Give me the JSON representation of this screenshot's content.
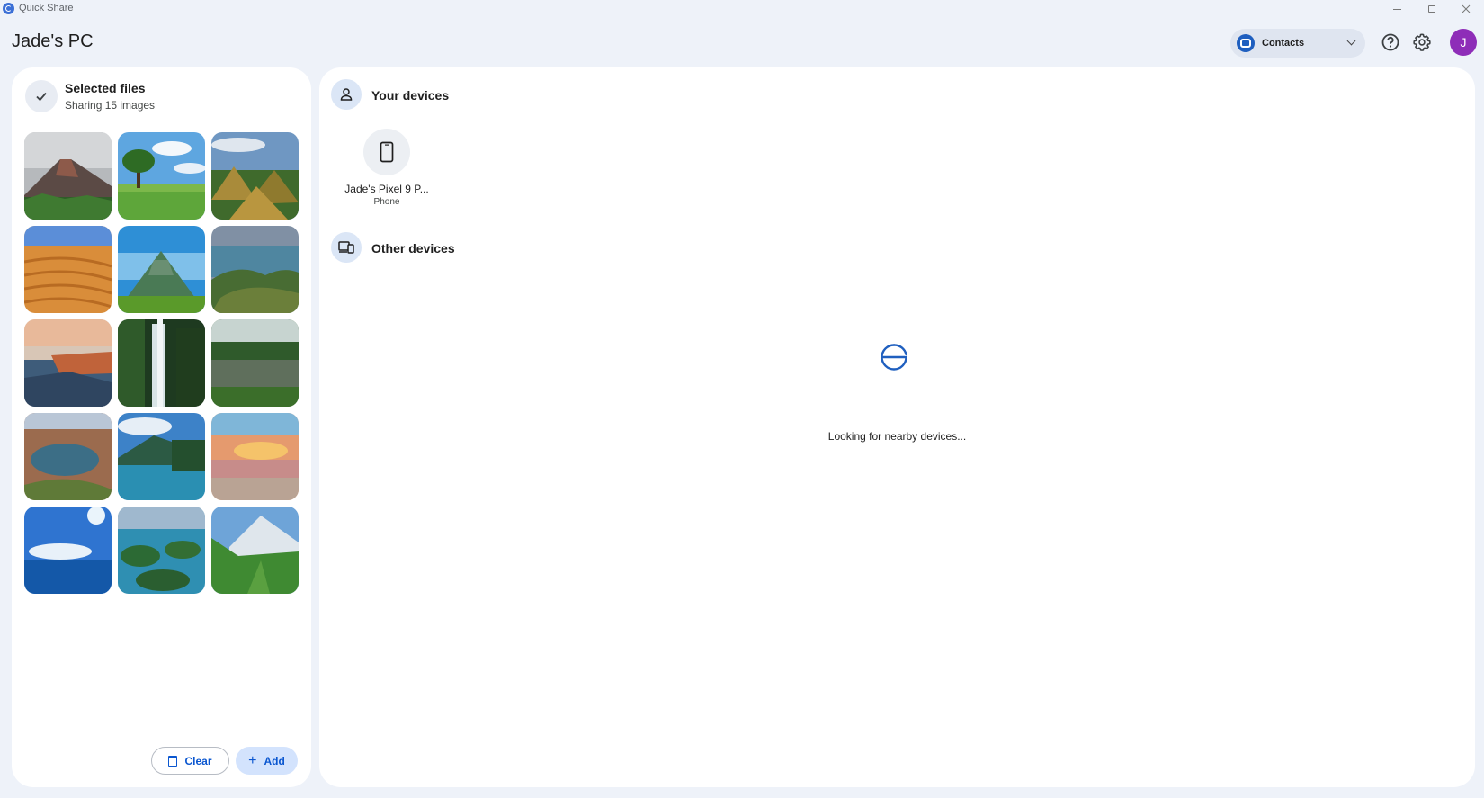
{
  "window": {
    "app_title": "Quick Share"
  },
  "header": {
    "pc_name": "Jade's PC",
    "contacts_label": "Contacts",
    "avatar_letter": "J"
  },
  "selected_files": {
    "title": "Selected files",
    "subtitle": "Sharing 15 images",
    "images": [
      "volcano",
      "tree-meadow",
      "chocolate-hills",
      "desert-dunes",
      "green-volcano",
      "island-aerial",
      "cliff-plateau",
      "waterfall",
      "forest-pond",
      "crater-lake",
      "mountain-lake",
      "sunset-beach",
      "ocean-sky",
      "lagoon-islands",
      "alpine-valley"
    ],
    "clear_label": "Clear",
    "add_label": "Add"
  },
  "devices": {
    "your_devices_title": "Your devices",
    "your_devices": [
      {
        "name": "Jade's Pixel 9 P...",
        "type": "Phone"
      }
    ],
    "other_devices_title": "Other devices",
    "status": "Looking for nearby devices..."
  },
  "colors": {
    "accent": "#0b57d0",
    "avatar": "#8e2db8",
    "background": "#eef2f9"
  }
}
